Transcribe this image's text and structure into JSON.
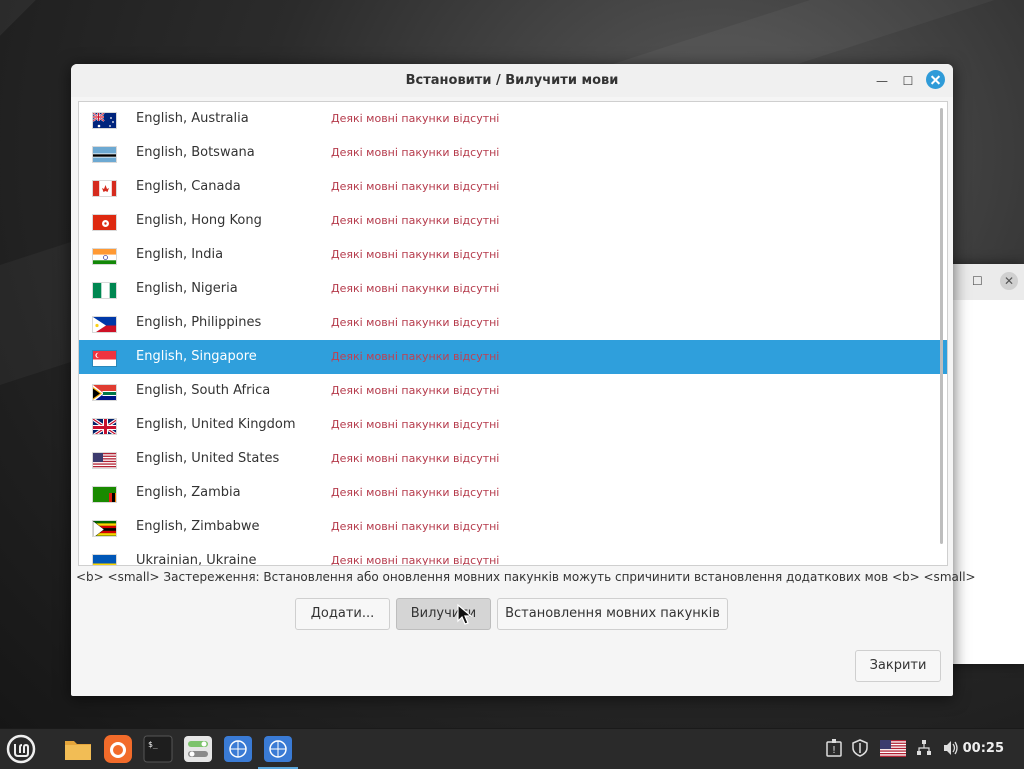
{
  "dialog": {
    "title": "Встановити / Вилучити мови",
    "warning": "<b> <small> Застереження: Встановлення або оновлення мовних пакунків можуть спричинити встановлення додаткових мов <b> <small>",
    "buttons": {
      "add": "Додати...",
      "remove": "Вилучити",
      "install_packs": "Встановлення мовних пакунків",
      "close": "Закрити"
    }
  },
  "languages": [
    {
      "name": "English, Australia",
      "status": "Деякі мовні пакунки відсутні",
      "flag": "au-flag-icon"
    },
    {
      "name": "English, Botswana",
      "status": "Деякі мовні пакунки відсутні",
      "flag": "bw-flag-icon"
    },
    {
      "name": "English, Canada",
      "status": "Деякі мовні пакунки відсутні",
      "flag": "ca-flag-icon"
    },
    {
      "name": "English, Hong Kong",
      "status": "Деякі мовні пакунки відсутні",
      "flag": "hk-flag-icon"
    },
    {
      "name": "English, India",
      "status": "Деякі мовні пакунки відсутні",
      "flag": "in-flag-icon"
    },
    {
      "name": "English, Nigeria",
      "status": "Деякі мовні пакунки відсутні",
      "flag": "ng-flag-icon"
    },
    {
      "name": "English, Philippines",
      "status": "Деякі мовні пакунки відсутні",
      "flag": "ph-flag-icon"
    },
    {
      "name": "English, Singapore",
      "status": "Деякі мовні пакунки відсутні",
      "flag": "sg-flag-icon",
      "selected": true
    },
    {
      "name": "English, South Africa",
      "status": "Деякі мовні пакунки відсутні",
      "flag": "za-flag-icon"
    },
    {
      "name": "English, United Kingdom",
      "status": "Деякі мовні пакунки відсутні",
      "flag": "gb-flag-icon"
    },
    {
      "name": "English, United States",
      "status": "Деякі мовні пакунки відсутні",
      "flag": "us-flag-icon"
    },
    {
      "name": "English, Zambia",
      "status": "Деякі мовні пакунки відсутні",
      "flag": "zm-flag-icon"
    },
    {
      "name": "English, Zimbabwe",
      "status": "Деякі мовні пакунки відсутні",
      "flag": "zw-flag-icon"
    },
    {
      "name": "Ukrainian, Ukraine",
      "status": "Деякі мовні пакунки відсутні",
      "flag": "ua-flag-icon"
    }
  ],
  "taskbar": {
    "clock": "00:25",
    "apps": [
      "mint-menu-icon",
      "files-icon",
      "firefox-icon",
      "terminal-icon",
      "settings-icon",
      "language-icon",
      "language-icon"
    ]
  },
  "colors": {
    "selection": "#2f9fdc",
    "status_text": "#b53a4b",
    "close_button": "#2f9bd8"
  }
}
